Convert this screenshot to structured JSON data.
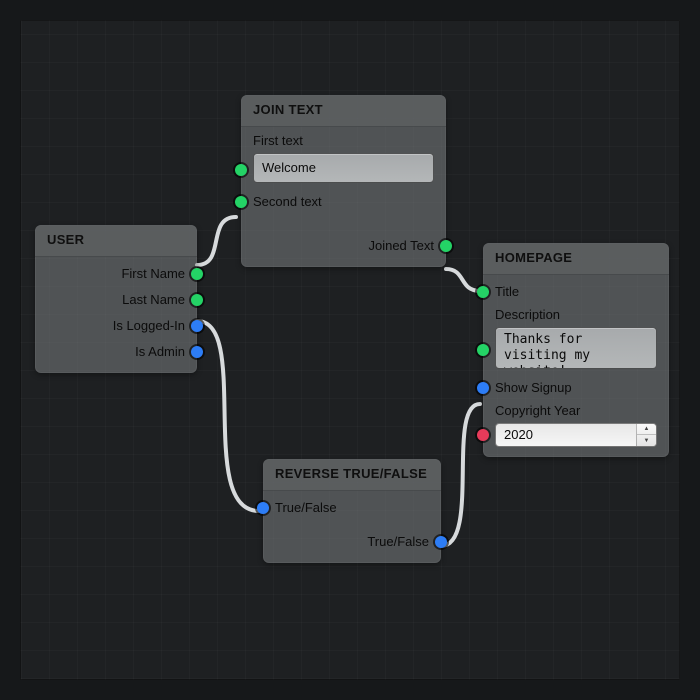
{
  "nodes": {
    "user": {
      "title": "USER",
      "outputs": {
        "first_name": "First Name",
        "last_name": "Last Name",
        "is_logged_in": "Is Logged-In",
        "is_admin": "Is Admin"
      }
    },
    "join_text": {
      "title": "JOIN TEXT",
      "inputs": {
        "first_text_label": "First text",
        "first_text_value": "Welcome ",
        "second_text_label": "Second text"
      },
      "outputs": {
        "joined_text": "Joined Text"
      }
    },
    "reverse": {
      "title": "REVERSE TRUE/FALSE",
      "inputs": {
        "in": "True/False"
      },
      "outputs": {
        "out": "True/False"
      }
    },
    "homepage": {
      "title": "HOMEPAGE",
      "inputs": {
        "title": "Title",
        "description_label": "Description",
        "description_value": "Thanks for visiting my website!",
        "show_signup": "Show Signup",
        "copyright_label": "Copyright Year",
        "copyright_value": "2020"
      }
    }
  },
  "port_colors": {
    "text": "#24d366",
    "bool": "#2d7df6",
    "number": "#e63b5a"
  },
  "connections": [
    {
      "from": "user.first_name",
      "to": "join_text.second_text",
      "type": "text"
    },
    {
      "from": "join_text.joined_text",
      "to": "homepage.title",
      "type": "text"
    },
    {
      "from": "user.is_logged_in",
      "to": "reverse.in",
      "type": "bool"
    },
    {
      "from": "reverse.out",
      "to": "homepage.show_signup",
      "type": "bool"
    }
  ]
}
